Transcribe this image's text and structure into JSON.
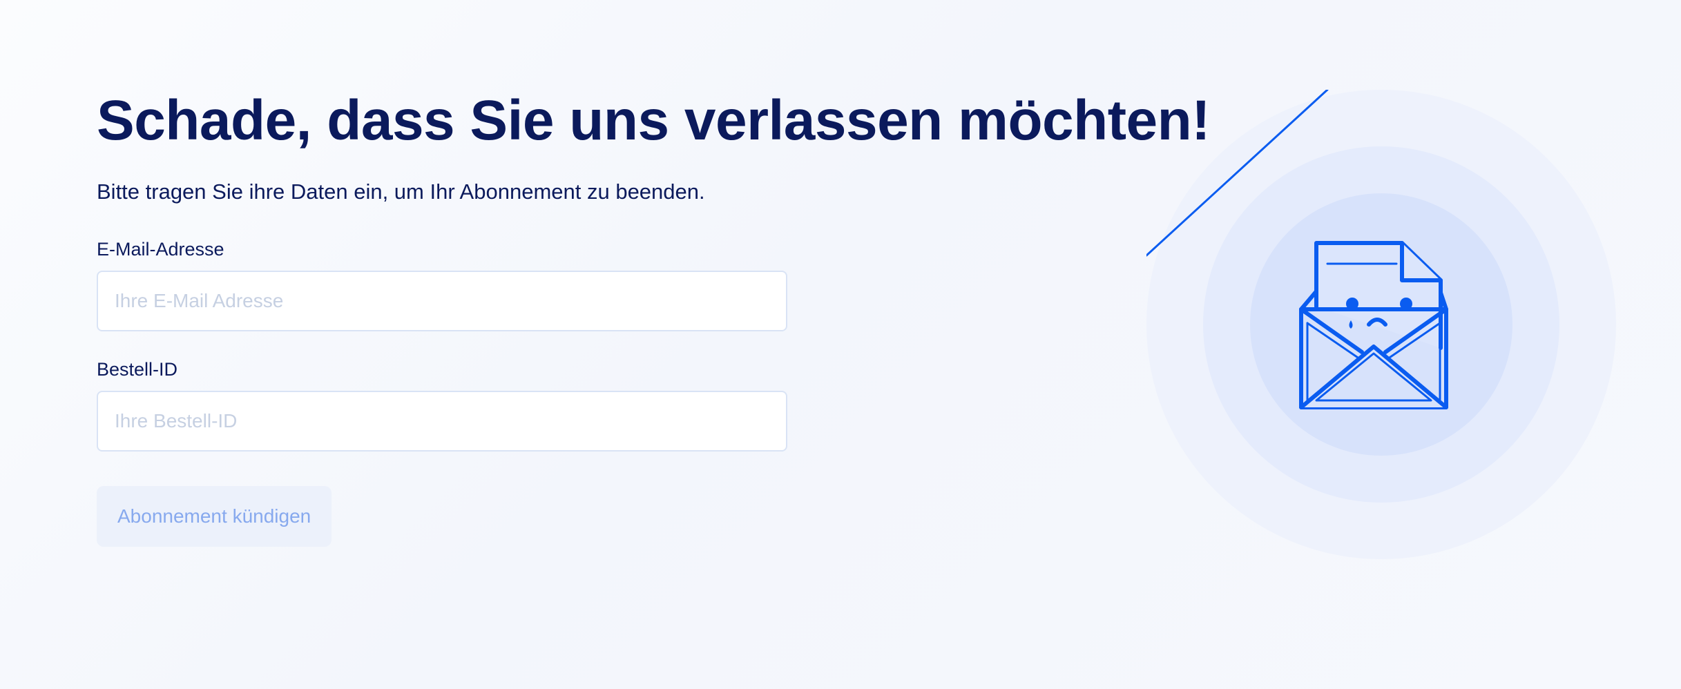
{
  "heading": "Schade, dass Sie uns verlassen möchten!",
  "subheading": "Bitte tragen Sie ihre Daten ein, um Ihr Abonnement zu beenden.",
  "form": {
    "email": {
      "label": "E-Mail-Adresse",
      "placeholder": "Ihre E-Mail Adresse",
      "value": ""
    },
    "order_id": {
      "label": "Bestell-ID",
      "placeholder": "Ihre Bestell-ID",
      "value": ""
    },
    "submit_label": "Abonnement kündigen",
    "submit_enabled": false
  },
  "illustration": {
    "icon": "sad-envelope-icon"
  },
  "colors": {
    "heading": "#0b1a5c",
    "accent": "#0a5cf0",
    "button_bg_disabled": "#ecf1fb",
    "button_text_disabled": "#87a9ee",
    "input_border": "#d9e3f5",
    "placeholder": "#c6d0e2"
  }
}
